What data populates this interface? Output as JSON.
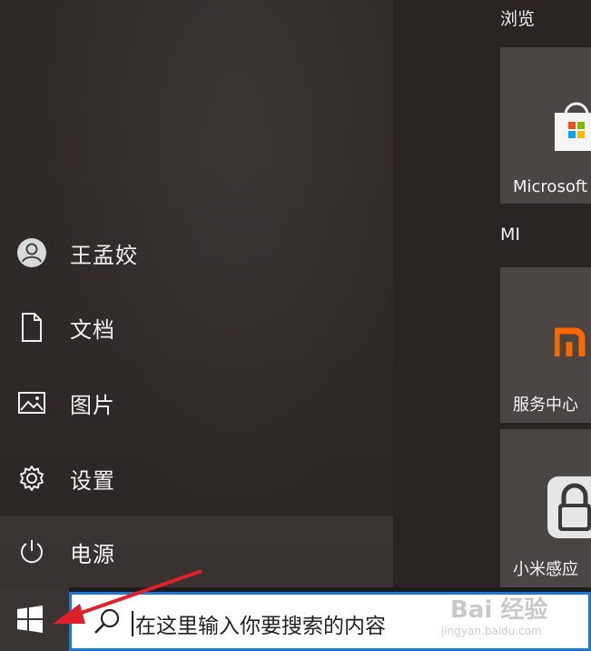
{
  "start_menu": {
    "user": {
      "name": "王孟姣",
      "icon": "user-avatar-icon"
    },
    "items": [
      {
        "label": "文档",
        "icon": "document-icon"
      },
      {
        "label": "图片",
        "icon": "pictures-icon"
      },
      {
        "label": "设置",
        "icon": "gear-icon"
      },
      {
        "label": "电源",
        "icon": "power-icon"
      }
    ]
  },
  "tiles": {
    "groups": [
      {
        "title": "浏览",
        "tile_label": "Microsoft"
      },
      {
        "title": "MI",
        "tile_label": "服务中心"
      },
      {
        "title": "",
        "tile_label": "小米感应"
      }
    ]
  },
  "taskbar": {
    "search_placeholder": "在这里输入你要搜索的内容"
  },
  "watermark": {
    "text": "Bai 经验",
    "sub": "jingyan.baidu.com"
  },
  "colors": {
    "accent": "#1a78d8",
    "arrow": "#e0202a",
    "mi_orange": "#ff6700",
    "store_red": "#f25022",
    "store_green": "#7fba00",
    "store_blue": "#00a4ef",
    "store_yellow": "#ffb900"
  }
}
